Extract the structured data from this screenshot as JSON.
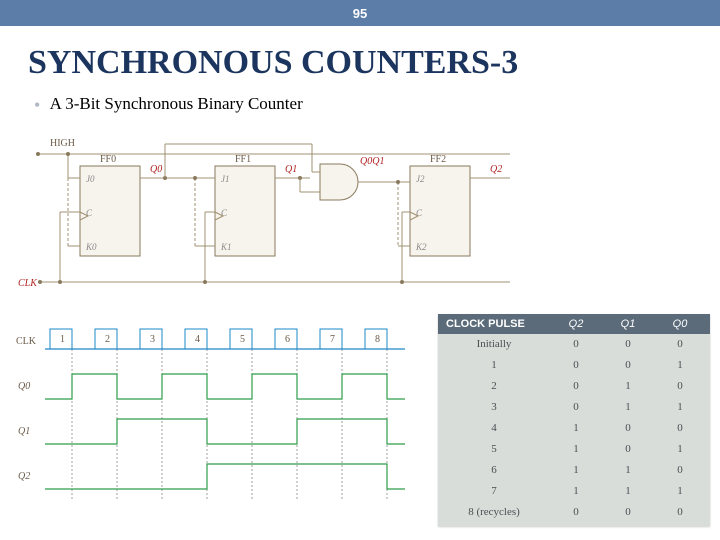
{
  "page_number": "95",
  "title": "SYNCHRONOUS COUNTERS-3",
  "subtitle": "A 3-Bit Synchronous Binary Counter",
  "circuit": {
    "high": "HIGH",
    "clk": "CLK",
    "ff": [
      "FF0",
      "FF1",
      "FF2"
    ],
    "j": [
      "J0",
      "J1",
      "J2"
    ],
    "k": [
      "K0",
      "K1",
      "K2"
    ],
    "c": [
      "C",
      "C",
      "C"
    ],
    "q": [
      "Q0",
      "Q1",
      "Q2"
    ],
    "q0q1": "Q0Q1"
  },
  "timing": {
    "clk": "CLK",
    "signals": [
      "Q0",
      "Q1",
      "Q2"
    ],
    "ticks": [
      "1",
      "2",
      "3",
      "4",
      "5",
      "6",
      "7",
      "8"
    ]
  },
  "truth": {
    "header_pulse": "CLOCK PULSE",
    "header_cols": [
      "Q2",
      "Q1",
      "Q0"
    ],
    "rows": [
      {
        "pulse": "Initially",
        "q2": "0",
        "q1": "0",
        "q0": "0"
      },
      {
        "pulse": "1",
        "q2": "0",
        "q1": "0",
        "q0": "1"
      },
      {
        "pulse": "2",
        "q2": "0",
        "q1": "1",
        "q0": "0"
      },
      {
        "pulse": "3",
        "q2": "0",
        "q1": "1",
        "q0": "1"
      },
      {
        "pulse": "4",
        "q2": "1",
        "q1": "0",
        "q0": "0"
      },
      {
        "pulse": "5",
        "q2": "1",
        "q1": "0",
        "q0": "1"
      },
      {
        "pulse": "6",
        "q2": "1",
        "q1": "1",
        "q0": "0"
      },
      {
        "pulse": "7",
        "q2": "1",
        "q1": "1",
        "q0": "1"
      },
      {
        "pulse": "8 (recycles)",
        "q2": "0",
        "q1": "0",
        "q0": "0"
      }
    ]
  }
}
